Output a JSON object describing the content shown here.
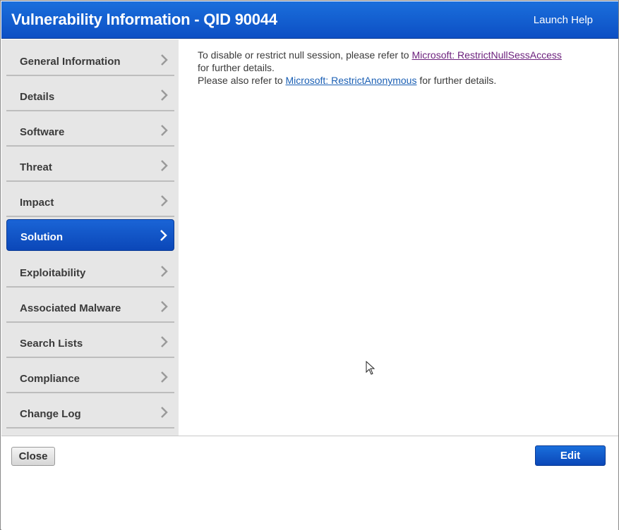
{
  "window": {
    "title": "Vulnerability Information - QID 90044",
    "help_label": "Launch Help"
  },
  "sidebar": {
    "items": [
      {
        "label": "General Information",
        "icon": "chevron-right-icon"
      },
      {
        "label": "Details",
        "icon": "chevron-right-icon"
      },
      {
        "label": "Software",
        "icon": "chevron-right-icon"
      },
      {
        "label": "Threat",
        "icon": "chevron-right-icon"
      },
      {
        "label": "Impact",
        "icon": "chevron-right-icon"
      },
      {
        "label": "Solution",
        "icon": "chevron-right-icon",
        "active": true
      },
      {
        "label": "Exploitability",
        "icon": "chevron-right-icon"
      },
      {
        "label": "Associated Malware",
        "icon": "chevron-right-icon"
      },
      {
        "label": "Search Lists",
        "icon": "chevron-right-icon"
      },
      {
        "label": "Compliance",
        "icon": "chevron-right-icon"
      },
      {
        "label": "Change Log",
        "icon": "chevron-right-icon"
      }
    ]
  },
  "solution": {
    "line1_prefix": "To disable or restrict null session, please refer to ",
    "link1": "Microsoft: RestrictNullSessAccess",
    "line2": "for further details.",
    "line3_prefix": "Please also refer to ",
    "link2": "Microsoft: RestrictAnonymous",
    "line3_suffix": " for further details."
  },
  "footer": {
    "close_label": "Close",
    "edit_label": "Edit"
  },
  "colors": {
    "accent": "#0d4fc4",
    "sidebar_bg": "#e6e6e6",
    "visited_link": "#6b1f7c",
    "link": "#1a5fb4"
  }
}
